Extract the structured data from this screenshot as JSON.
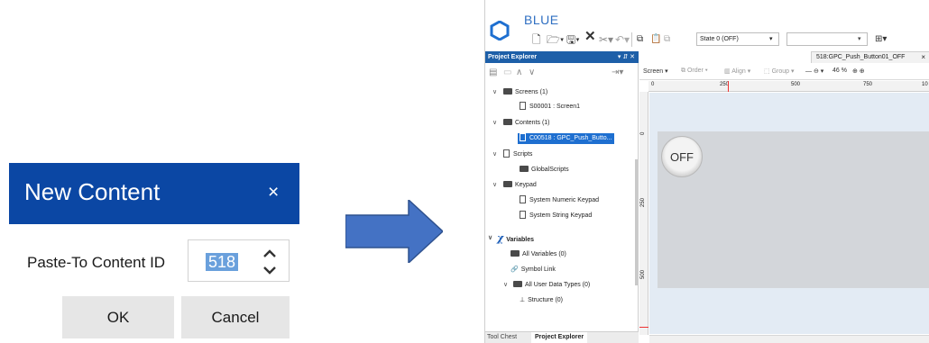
{
  "dialog": {
    "title": "New Content",
    "close_glyph": "×",
    "paste_to_label": "Paste-To Content ID",
    "content_id_value": "518",
    "ok_label": "OK",
    "cancel_label": "Cancel",
    "title_bar_color": "#0b47a4"
  },
  "arrow": {
    "color": "#4472c4",
    "icon": "right-arrow-icon"
  },
  "app": {
    "title": "BLUE",
    "toolbar": {
      "state_combo_value": "State 0 (OFF)"
    },
    "project_explorer": {
      "header": "Project Explorer",
      "header_buttons": "▾ ⇵ ✕",
      "tree": [
        {
          "label": "Screens (1)",
          "kind": "folder",
          "expanded": true
        },
        {
          "label": "S00001 : Screen1",
          "kind": "doc"
        },
        {
          "label": "Contents (1)",
          "kind": "folder",
          "expanded": true
        },
        {
          "label": "C00518 : GPC_Push_Butto...",
          "kind": "doc",
          "selected": true
        },
        {
          "label": "Scripts",
          "kind": "folder",
          "expanded": true
        },
        {
          "label": "GlobalScripts",
          "kind": "doc"
        },
        {
          "label": "Keypad",
          "kind": "folder",
          "expanded": true
        },
        {
          "label": "System Numeric Keypad",
          "kind": "doc"
        },
        {
          "label": "System String Keypad",
          "kind": "doc"
        },
        {
          "label": "Variables",
          "kind": "section",
          "expanded": true
        },
        {
          "label": "All Variables (0)",
          "kind": "folder"
        },
        {
          "label": "Symbol Link",
          "kind": "doc"
        },
        {
          "label": "All User Data Types (0)",
          "kind": "folder",
          "expanded": true
        },
        {
          "label": "Structure (0)",
          "kind": "doc"
        }
      ],
      "tabs": [
        "Tool Chest",
        "Project Explorer"
      ],
      "active_tab": "Project Explorer"
    },
    "editor": {
      "doc_tab": "518:GPC_Push_Button01_OFF",
      "doc_tab_close": "×",
      "tools": {
        "screen": "Screen",
        "order": "Order",
        "align": "Align",
        "group": "Group",
        "zoom": "46 %"
      },
      "ruler_h_labels": [
        "0",
        "250",
        "500",
        "750",
        "10"
      ],
      "ruler_v_labels": [
        "0",
        "250",
        "500"
      ],
      "button_text": "OFF",
      "selection_color": "#1e6fd0"
    }
  }
}
